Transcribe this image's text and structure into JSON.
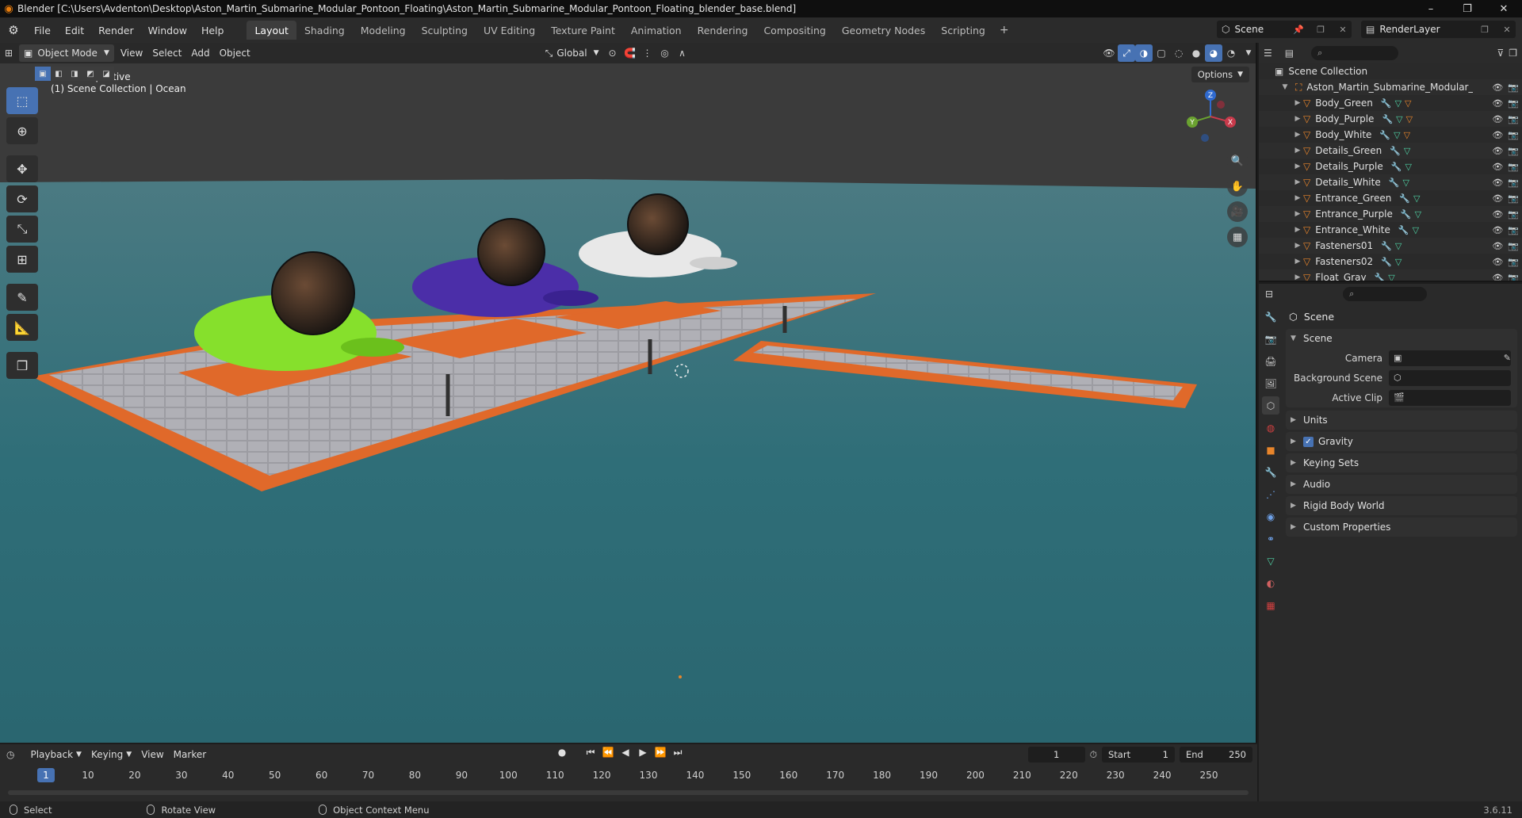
{
  "window": {
    "title": "Blender [C:\\Users\\Avdenton\\Desktop\\Aston_Martin_Submarine_Modular_Pontoon_Floating\\Aston_Martin_Submarine_Modular_Pontoon_Floating_blender_base.blend]",
    "controls": [
      "–",
      "❐",
      "✕"
    ]
  },
  "menu": [
    "File",
    "Edit",
    "Render",
    "Window",
    "Help"
  ],
  "workspaces": [
    "Layout",
    "Shading",
    "Modeling",
    "Sculpting",
    "UV Editing",
    "Texture Paint",
    "Animation",
    "Rendering",
    "Compositing",
    "Geometry Nodes",
    "Scripting"
  ],
  "active_workspace": "Layout",
  "scene_name": "Scene",
  "view_layer": "RenderLayer",
  "viewport": {
    "mode": "Object Mode",
    "menus": [
      "View",
      "Select",
      "Add",
      "Object"
    ],
    "transform_orientation": "Global",
    "options": "Options",
    "perspective": "User Perspective",
    "collection_info": "(1) Scene Collection | Ocean",
    "gizmo_axes": {
      "z": "Z",
      "y": "Y",
      "x": "X"
    }
  },
  "outliner": {
    "root": "Scene Collection",
    "collection": "Aston_Martin_Submarine_Modular_Ponto",
    "objects": [
      {
        "name": "Body_Green",
        "mods": 3
      },
      {
        "name": "Body_Purple",
        "mods": 3
      },
      {
        "name": "Body_White",
        "mods": 3
      },
      {
        "name": "Details_Green",
        "mods": 2
      },
      {
        "name": "Details_Purple",
        "mods": 2
      },
      {
        "name": "Details_White",
        "mods": 2
      },
      {
        "name": "Entrance_Green",
        "mods": 2
      },
      {
        "name": "Entrance_Purple",
        "mods": 2
      },
      {
        "name": "Entrance_White",
        "mods": 2
      },
      {
        "name": "Fasteners01",
        "mods": 2
      },
      {
        "name": "Fasteners02",
        "mods": 2
      },
      {
        "name": "Float_Gray",
        "mods": 2
      }
    ]
  },
  "properties": {
    "context": "Scene",
    "panel_title": "Scene",
    "fields": [
      {
        "label": "Camera",
        "value": ""
      },
      {
        "label": "Background Scene",
        "value": ""
      },
      {
        "label": "Active Clip",
        "value": ""
      }
    ],
    "panels": [
      "Units",
      "Gravity",
      "Keying Sets",
      "Audio",
      "Rigid Body World",
      "Custom Properties"
    ],
    "gravity_checked": true
  },
  "timeline": {
    "menus": [
      "Playback",
      "Keying",
      "View",
      "Marker"
    ],
    "current_frame": "1",
    "start_label": "Start",
    "start": "1",
    "end_label": "End",
    "end": "250",
    "ticks": [
      "10",
      "20",
      "30",
      "40",
      "50",
      "60",
      "70",
      "80",
      "90",
      "100",
      "110",
      "120",
      "130",
      "140",
      "150",
      "160",
      "170",
      "180",
      "190",
      "200",
      "210",
      "220",
      "230",
      "240",
      "250"
    ]
  },
  "statusbar": {
    "items": [
      "Select",
      "Rotate View",
      "Object Context Menu"
    ],
    "version": "3.6.11"
  },
  "colors": {
    "accent": "#4772b3",
    "object_icon": "#e8852b",
    "water": "#2f6e78",
    "pontoon_orange": "#e0692a",
    "sub_green": "#86e02c",
    "sub_purple": "#4b2ea8",
    "sub_white": "#e8e8e8"
  }
}
